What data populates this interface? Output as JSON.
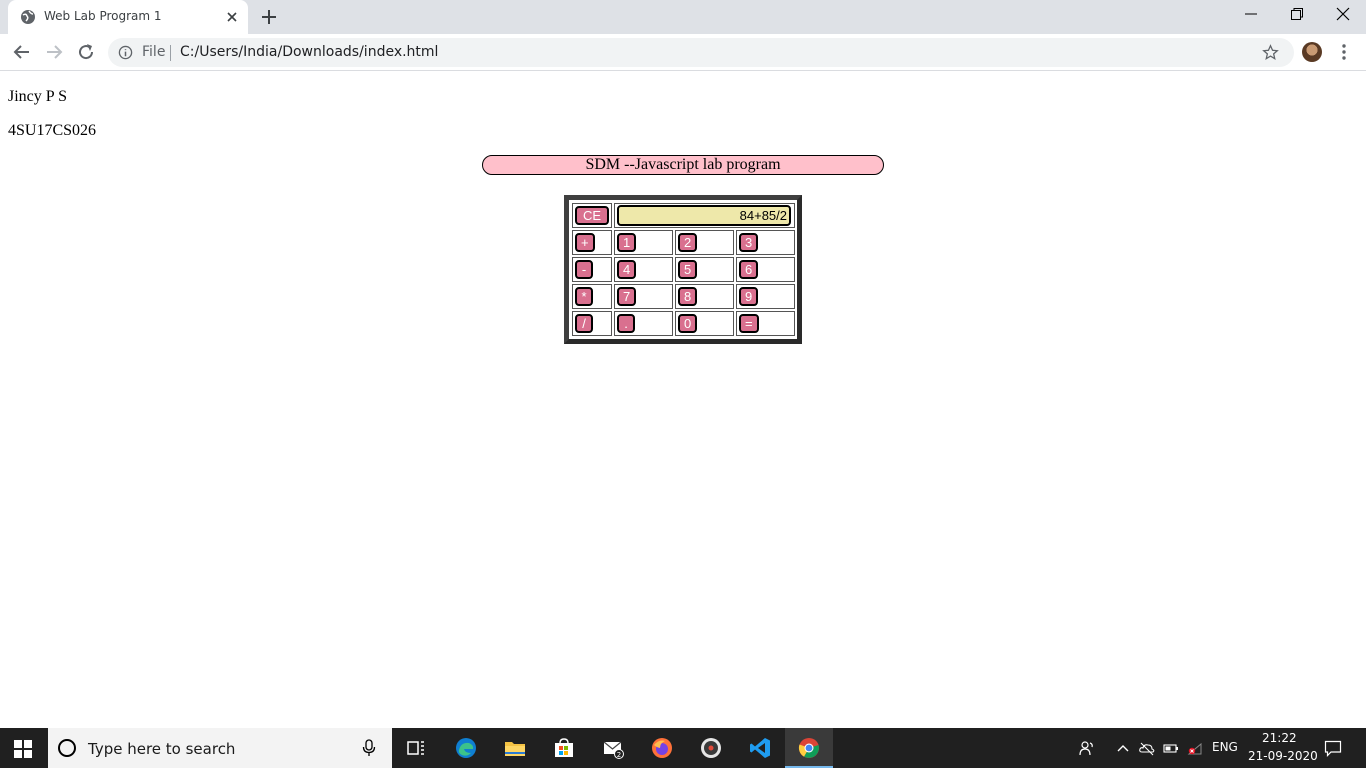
{
  "browser": {
    "tab_title": "Web Lab Program 1",
    "scheme_label": "File",
    "url": "C:/Users/India/Downloads/index.html"
  },
  "page": {
    "name_line": "Jincy P S",
    "usn_line": "4SU17CS026",
    "banner": "SDM --Javascript lab program"
  },
  "calculator": {
    "clear_label": "CE",
    "display_value": "84+85/2",
    "rows": [
      [
        "+",
        "1",
        "2",
        "3"
      ],
      [
        "-",
        "4",
        "5",
        "6"
      ],
      [
        "*",
        "7",
        "8",
        "9"
      ],
      [
        "/",
        ".",
        "0",
        "="
      ]
    ],
    "colors": {
      "key_bg": "#d9708f",
      "display_bg": "#eee8aa",
      "banner_bg": "#ffc0cb",
      "frame": "#3f3f3f"
    }
  },
  "taskbar": {
    "search_placeholder": "Type here to search",
    "mail_badge": "2",
    "language": "ENG",
    "time": "21:22",
    "date": "21-09-2020"
  }
}
